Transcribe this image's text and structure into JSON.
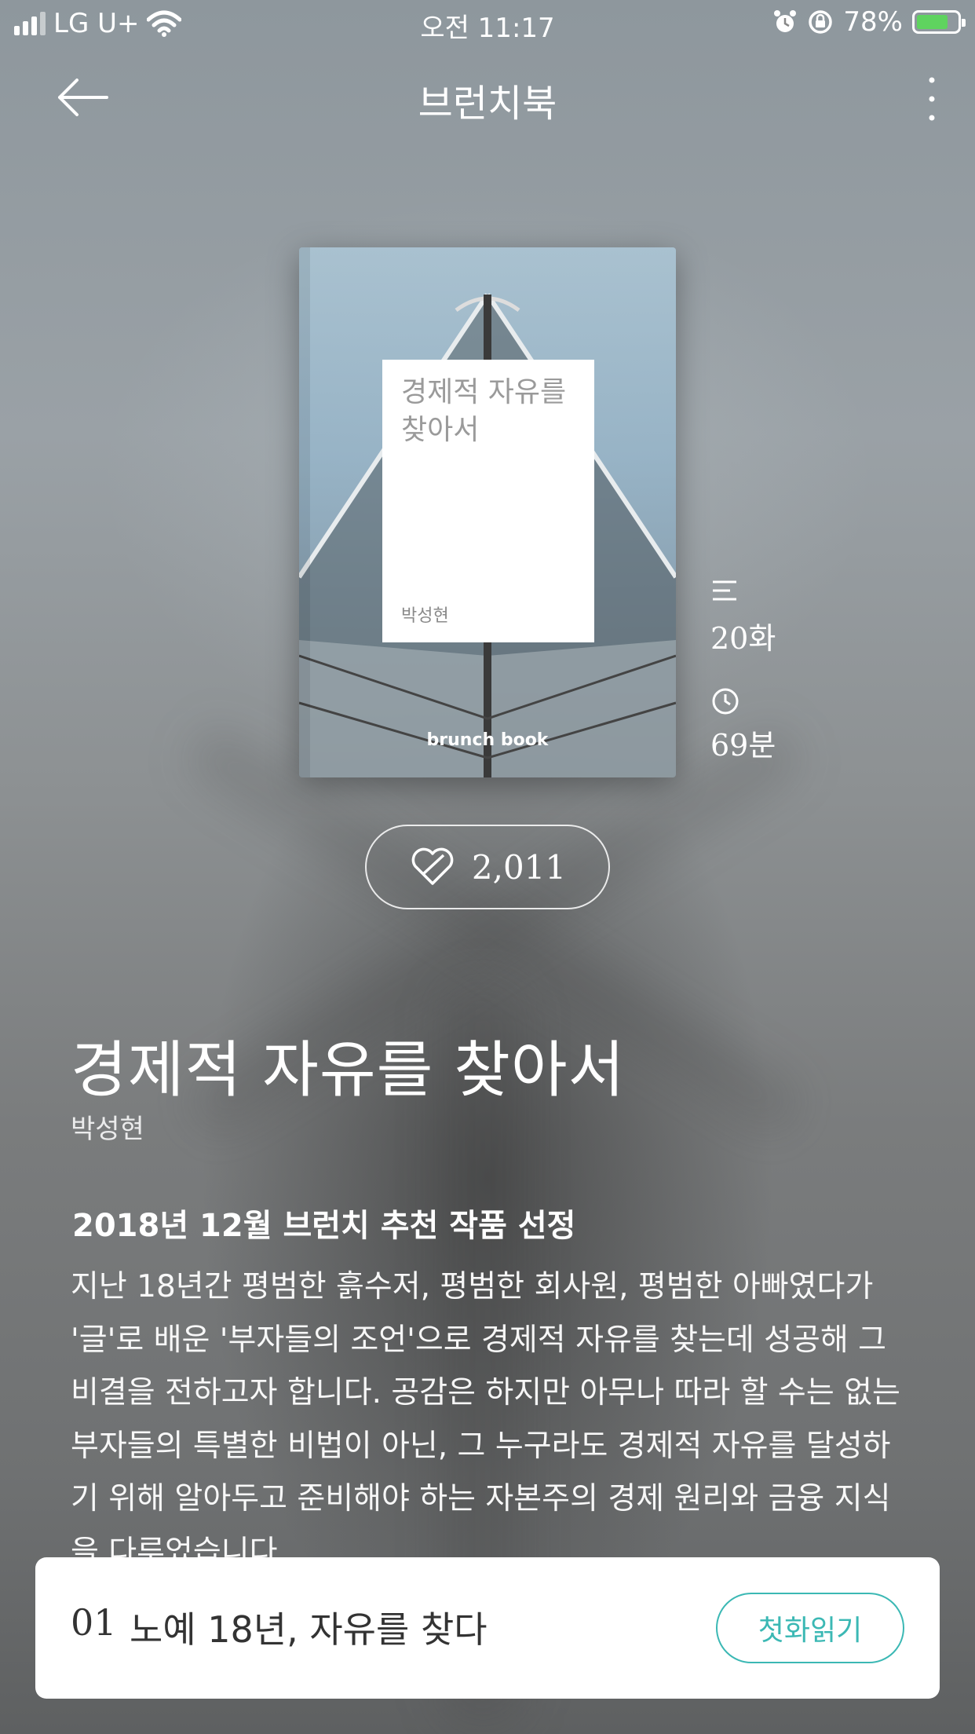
{
  "status_bar": {
    "carrier": "LG U+",
    "time": "오전 11:17",
    "battery": "78%",
    "battery_level": 0.78
  },
  "nav": {
    "title": "브런치북"
  },
  "cover": {
    "title": "경제적 자유를 찾아서",
    "author": "박성현",
    "brand": "brunch book"
  },
  "meta": {
    "episodes": "20화",
    "duration": "69분"
  },
  "like": {
    "count": "2,011"
  },
  "book": {
    "title": "경제적 자유를 찾아서",
    "author": "박성현",
    "award": "2018년 12월 브런치 추천 작품 선정",
    "description": "지난 18년간 평범한 흙수저, 평범한 회사원, 평범한 아빠였다가 '글'로 배운 '부자들의 조언'으로 경제적 자유를 찾는데 성공해 그 비결을 전하고자 합니다. 공감은 하지만 아무나 따라 할 수는 없는 부자들의 특별한 비법이 아닌, 그 누구라도 경제적 자유를 달성하기 위해 알아두고 준비해야 하는 자본주의 경제 원리와 금융 지식을 다루었습니다."
  },
  "first_episode": {
    "number": "01",
    "title": "노예 18년, 자유를 찾다",
    "read_label": "첫화읽기"
  },
  "colors": {
    "accent": "#3bb8b4",
    "battery_charging": "#5fd35f"
  }
}
